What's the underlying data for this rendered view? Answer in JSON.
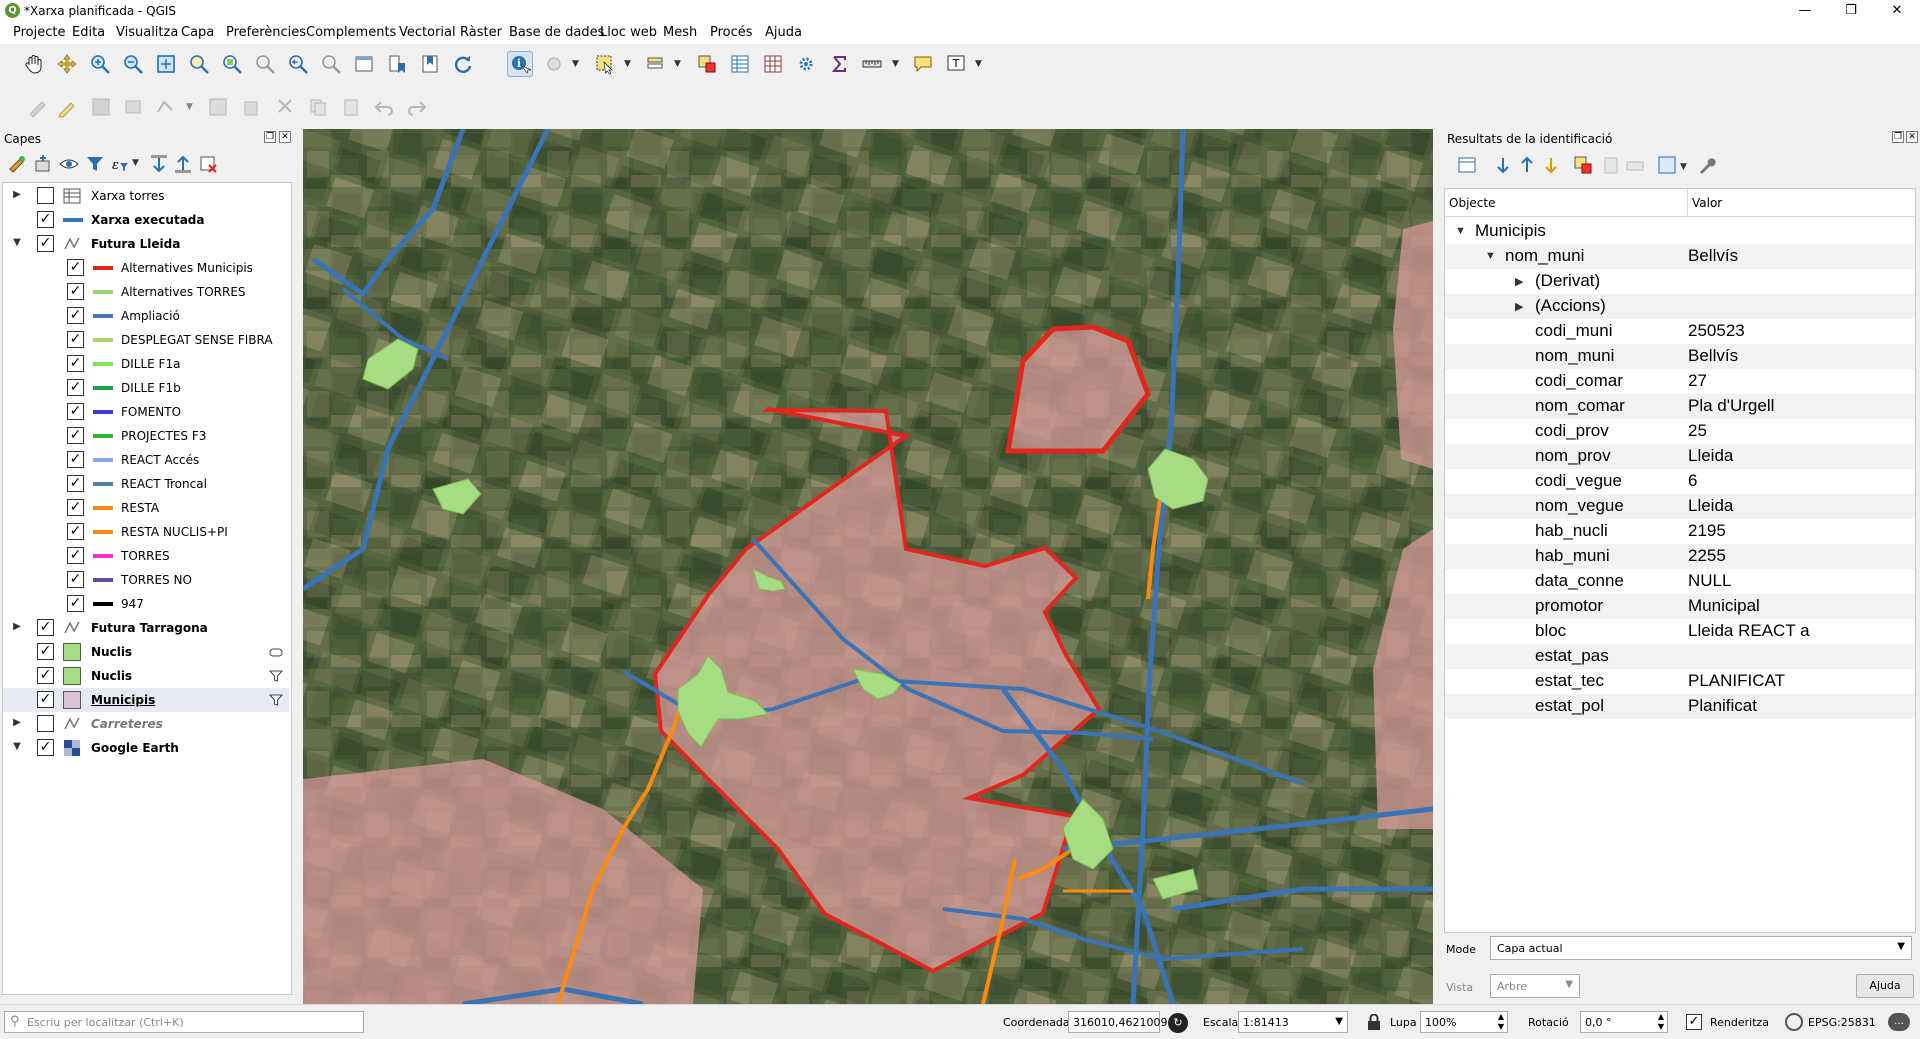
{
  "window": {
    "title": "*Xarxa planificada - QGIS",
    "logo": "Q"
  },
  "menu": [
    "Projecte",
    "Edita",
    "Visualitza",
    "Capa",
    "Preferències",
    "Complements",
    "Vectorial",
    "Ràster",
    "Base de dades",
    "Lloc web",
    "Mesh",
    "Procés",
    "Ajuda"
  ],
  "layers_panel": {
    "title": "Capes",
    "layers": [
      {
        "name": "Xarxa torres",
        "checked": false,
        "level": 0,
        "expander": "right",
        "symbol": "table-icon",
        "bold": false
      },
      {
        "name": "Xarxa executada",
        "checked": true,
        "level": 0,
        "expander": "none",
        "symbol": "line",
        "color": "#3a74b6",
        "bold": true
      },
      {
        "name": "Futura Lleida",
        "checked": true,
        "level": 0,
        "expander": "down",
        "symbol": "line-group-icon",
        "bold": true
      },
      {
        "name": "Alternatives Municipis",
        "checked": true,
        "level": 1,
        "symbol": "line",
        "color": "#e0271e"
      },
      {
        "name": "Alternatives TORRES",
        "checked": true,
        "level": 1,
        "symbol": "line",
        "color": "#9fd07a"
      },
      {
        "name": "Ampliació",
        "checked": true,
        "level": 1,
        "symbol": "line",
        "color": "#4a78b5"
      },
      {
        "name": "DESPLEGAT SENSE FIBRA",
        "checked": true,
        "level": 1,
        "symbol": "line",
        "color": "#a9d86b"
      },
      {
        "name": "DILLE F1a",
        "checked": true,
        "level": 1,
        "symbol": "line",
        "color": "#86e05a"
      },
      {
        "name": "DILLE F1b",
        "checked": true,
        "level": 1,
        "symbol": "line",
        "color": "#1e9e45"
      },
      {
        "name": "FOMENTO",
        "checked": true,
        "level": 1,
        "symbol": "line",
        "color": "#3a3adf"
      },
      {
        "name": "PROJECTES F3",
        "checked": true,
        "level": 1,
        "symbol": "line",
        "color": "#35b235"
      },
      {
        "name": "REACT Accés",
        "checked": true,
        "level": 1,
        "symbol": "line",
        "color": "#8aa8e8"
      },
      {
        "name": "REACT Troncal",
        "checked": true,
        "level": 1,
        "symbol": "line",
        "color": "#4f7fa8"
      },
      {
        "name": "RESTA",
        "checked": true,
        "level": 1,
        "symbol": "line",
        "color": "#ff8a10"
      },
      {
        "name": "RESTA NUCLIS+PI",
        "checked": true,
        "level": 1,
        "symbol": "line",
        "color": "#ff8a10"
      },
      {
        "name": "TORRES",
        "checked": true,
        "level": 1,
        "symbol": "line",
        "color": "#ff2ec2"
      },
      {
        "name": "TORRES NO",
        "checked": true,
        "level": 1,
        "symbol": "line",
        "color": "#5c4e9c"
      },
      {
        "name": "947",
        "checked": true,
        "level": 1,
        "symbol": "line",
        "color": "#000000"
      },
      {
        "name": "Futura Tarragona",
        "checked": true,
        "level": 0,
        "expander": "right",
        "symbol": "line-group-icon",
        "bold": true
      },
      {
        "name": "Nuclis",
        "checked": true,
        "level": 0,
        "expander": "none",
        "symbol": "fill",
        "color": "#a6dd83",
        "bold": true,
        "indicator": "embedded-icon"
      },
      {
        "name": "Nuclis",
        "checked": true,
        "level": 0,
        "expander": "none",
        "symbol": "fill",
        "color": "#a6dd83",
        "bold": true,
        "indicator": "filter-icon"
      },
      {
        "name": "Municipis",
        "checked": true,
        "level": 0,
        "expander": "none",
        "symbol": "fill",
        "color": "#d8c4d6",
        "bold": true,
        "underline": true,
        "selected": true,
        "indicator": "filter-icon"
      },
      {
        "name": "Carreteres",
        "checked": false,
        "level": 0,
        "expander": "right",
        "symbol": "line-group-icon",
        "bold": true,
        "italic": true,
        "disabled": true
      },
      {
        "name": "Google Earth",
        "checked": true,
        "level": 0,
        "expander": "down",
        "symbol": "raster-icon",
        "bold": true
      }
    ]
  },
  "identify_panel": {
    "title": "Resultats de la identificació",
    "headers": {
      "object": "Objecte",
      "value": "Valor"
    },
    "tree": [
      {
        "key": "Municipis",
        "value": "",
        "depth": 0,
        "tri": "down"
      },
      {
        "key": "nom_muni",
        "value": "Bellvís",
        "depth": 1,
        "tri": "down"
      },
      {
        "key": "(Derivat)",
        "value": "",
        "depth": 2,
        "tri": "right"
      },
      {
        "key": "(Accions)",
        "value": "",
        "depth": 2,
        "tri": "right"
      },
      {
        "key": "codi_muni",
        "value": "250523",
        "depth": 3
      },
      {
        "key": "nom_muni",
        "value": "Bellvís",
        "depth": 3
      },
      {
        "key": "codi_comar",
        "value": "27",
        "depth": 3
      },
      {
        "key": "nom_comar",
        "value": "Pla d'Urgell",
        "depth": 3
      },
      {
        "key": "codi_prov",
        "value": "25",
        "depth": 3
      },
      {
        "key": "nom_prov",
        "value": "Lleida",
        "depth": 3
      },
      {
        "key": "codi_vegue",
        "value": "6",
        "depth": 3
      },
      {
        "key": "nom_vegue",
        "value": "Lleida",
        "depth": 3
      },
      {
        "key": "hab_nucli",
        "value": "2195",
        "depth": 3
      },
      {
        "key": "hab_muni",
        "value": "2255",
        "depth": 3
      },
      {
        "key": "data_conne",
        "value": "NULL",
        "depth": 3
      },
      {
        "key": "promotor",
        "value": "Municipal",
        "depth": 3
      },
      {
        "key": "bloc",
        "value": "Lleida REACT a",
        "depth": 3
      },
      {
        "key": "estat_pas",
        "value": "",
        "depth": 3
      },
      {
        "key": "estat_tec",
        "value": "PLANIFICAT",
        "depth": 3
      },
      {
        "key": "estat_pol",
        "value": "Planificat",
        "depth": 3
      }
    ],
    "mode_label": "Mode",
    "mode_value": "Capa actual",
    "view_label": "Vista",
    "view_value": "Arbre",
    "help_button": "Ajuda"
  },
  "statusbar": {
    "search_placeholder": "Escriu per localitzar (Ctrl+K)",
    "coord_label": "Coordenada",
    "coord_value": "316010,4621009",
    "scale_label": "Escala",
    "scale_value": "1:81413",
    "magnifier_label": "Lupa",
    "magnifier_value": "100%",
    "rotation_label": "Rotació",
    "rotation_value": "0,0 °",
    "render_label": "Renderitza",
    "render_checked": true,
    "crs": "EPSG:25831"
  },
  "map": {
    "colors": {
      "municipality_fill": "#d59a98",
      "municipality_border": "#e0271e",
      "nucleus_fill": "#a6dd83",
      "network_blue": "#3a74b6",
      "network_orange": "#ff8a10",
      "field_dark": "#3b4a2e",
      "field_light": "#7a7a58"
    }
  }
}
